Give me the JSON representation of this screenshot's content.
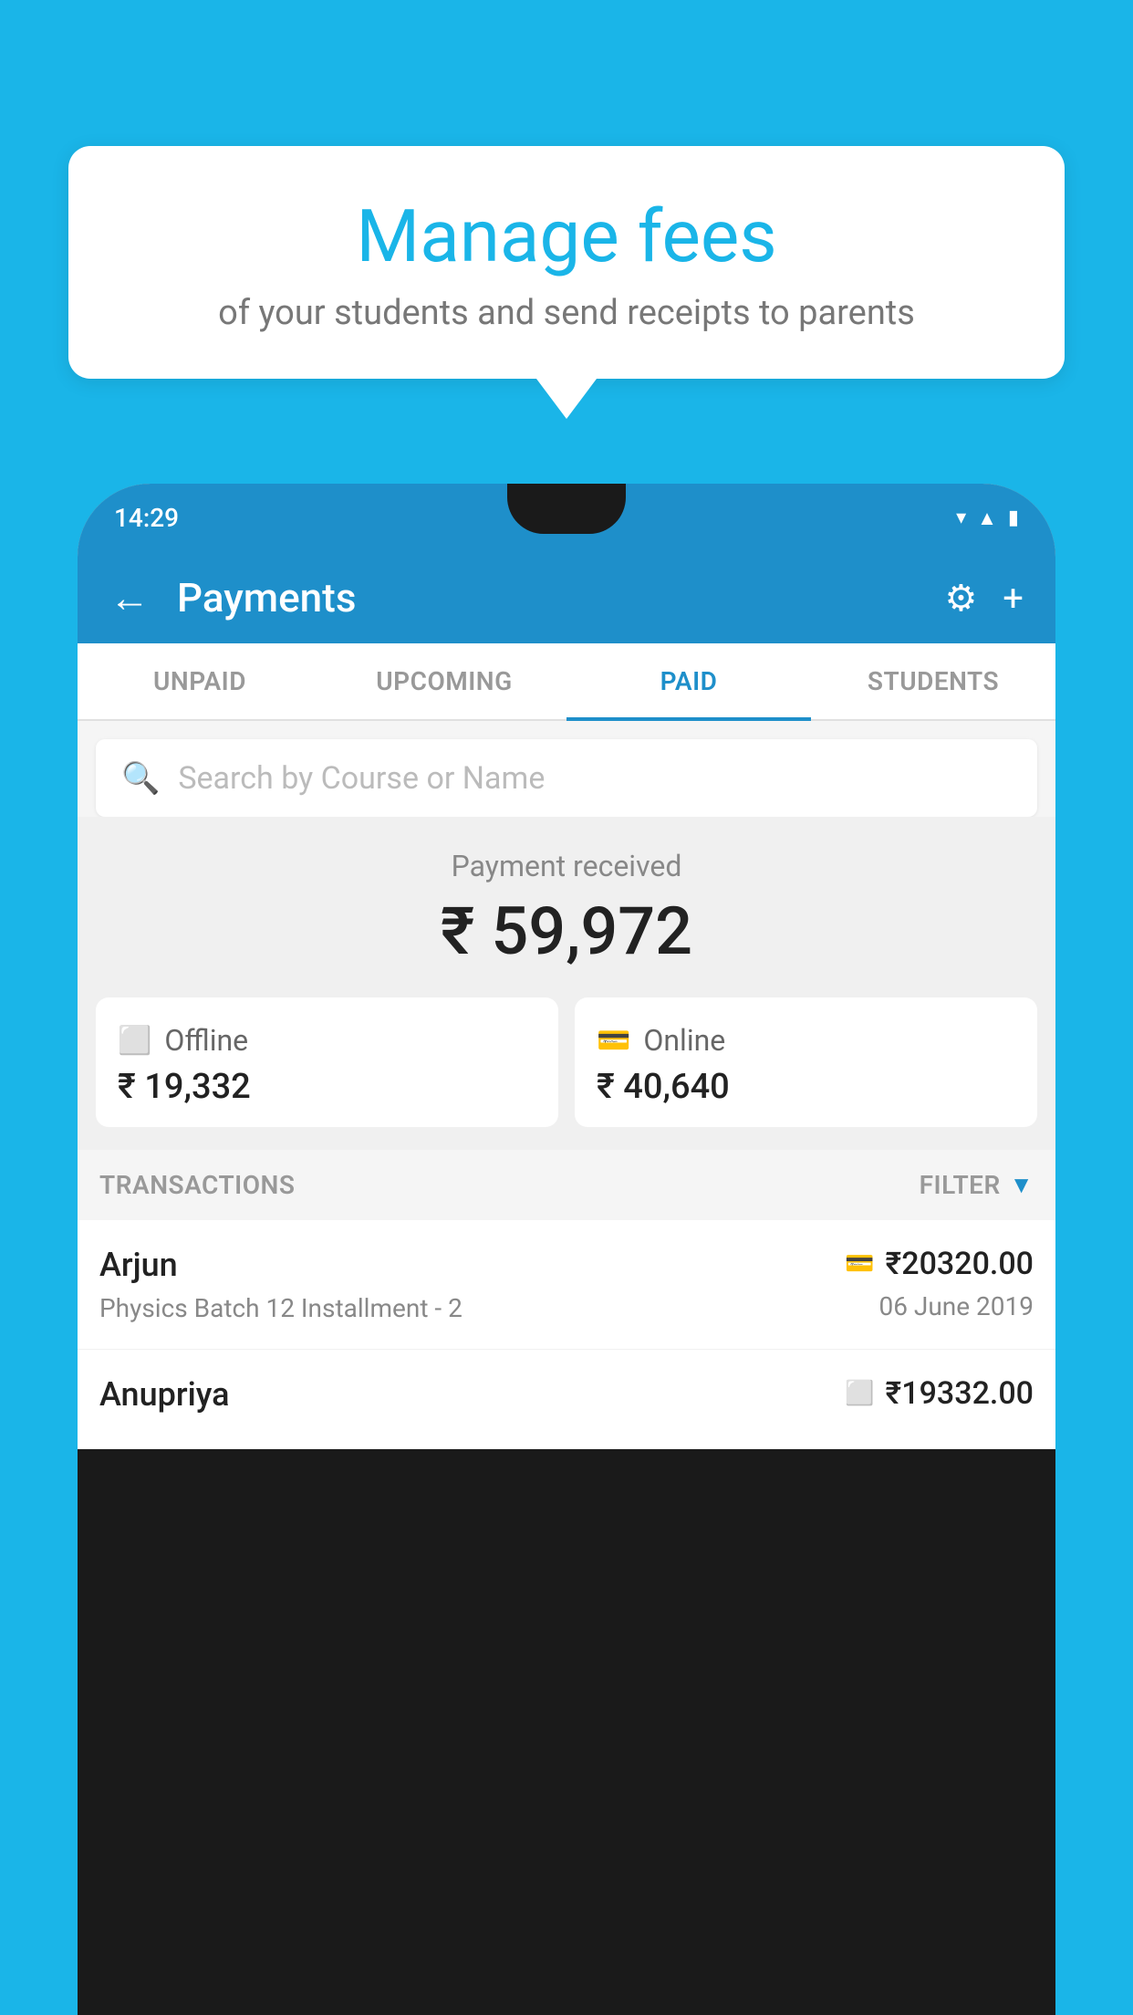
{
  "background_color": "#1ab5e8",
  "speech_bubble": {
    "title": "Manage fees",
    "subtitle": "of your students and send receipts to parents"
  },
  "phone": {
    "status_bar": {
      "time": "14:29"
    },
    "nav": {
      "title": "Payments",
      "back_label": "←",
      "settings_label": "⚙",
      "add_label": "+"
    },
    "tabs": [
      {
        "label": "UNPAID",
        "active": false
      },
      {
        "label": "UPCOMING",
        "active": false
      },
      {
        "label": "PAID",
        "active": true
      },
      {
        "label": "STUDENTS",
        "active": false
      }
    ],
    "search": {
      "placeholder": "Search by Course or Name"
    },
    "payment_summary": {
      "label": "Payment received",
      "amount": "₹ 59,972",
      "offline_label": "Offline",
      "offline_amount": "₹ 19,332",
      "online_label": "Online",
      "online_amount": "₹ 40,640"
    },
    "transactions": {
      "header": "TRANSACTIONS",
      "filter_label": "FILTER",
      "items": [
        {
          "name": "Arjun",
          "detail": "Physics Batch 12 Installment - 2",
          "amount": "₹20320.00",
          "date": "06 June 2019",
          "payment_type": "online"
        },
        {
          "name": "Anupriya",
          "detail": "",
          "amount": "₹19332.00",
          "date": "",
          "payment_type": "offline"
        }
      ]
    }
  }
}
